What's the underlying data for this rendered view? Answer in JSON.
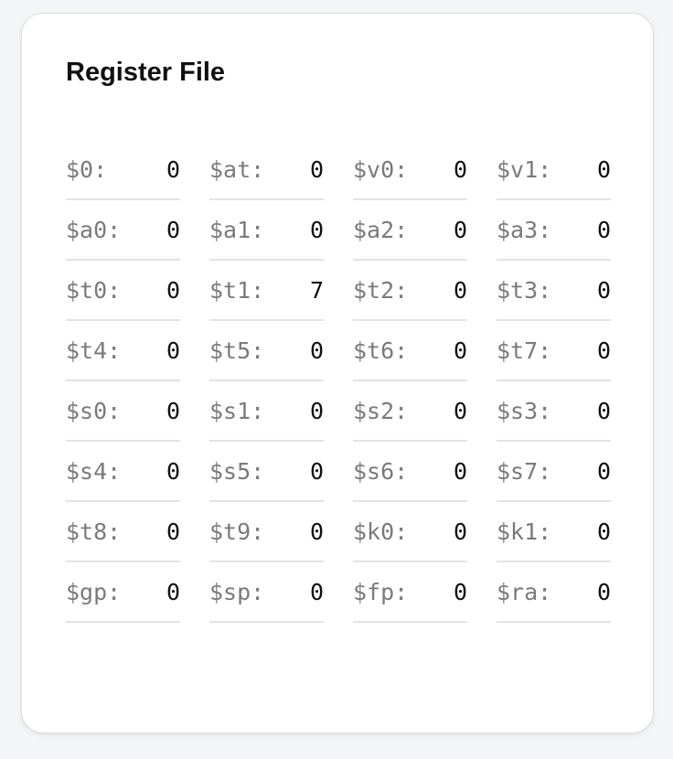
{
  "panel": {
    "title": "Register File"
  },
  "registers": [
    {
      "name": "$0:",
      "value": "0"
    },
    {
      "name": "$at:",
      "value": "0"
    },
    {
      "name": "$v0:",
      "value": "0"
    },
    {
      "name": "$v1:",
      "value": "0"
    },
    {
      "name": "$a0:",
      "value": "0"
    },
    {
      "name": "$a1:",
      "value": "0"
    },
    {
      "name": "$a2:",
      "value": "0"
    },
    {
      "name": "$a3:",
      "value": "0"
    },
    {
      "name": "$t0:",
      "value": "0"
    },
    {
      "name": "$t1:",
      "value": "7"
    },
    {
      "name": "$t2:",
      "value": "0"
    },
    {
      "name": "$t3:",
      "value": "0"
    },
    {
      "name": "$t4:",
      "value": "0"
    },
    {
      "name": "$t5:",
      "value": "0"
    },
    {
      "name": "$t6:",
      "value": "0"
    },
    {
      "name": "$t7:",
      "value": "0"
    },
    {
      "name": "$s0:",
      "value": "0"
    },
    {
      "name": "$s1:",
      "value": "0"
    },
    {
      "name": "$s2:",
      "value": "0"
    },
    {
      "name": "$s3:",
      "value": "0"
    },
    {
      "name": "$s4:",
      "value": "0"
    },
    {
      "name": "$s5:",
      "value": "0"
    },
    {
      "name": "$s6:",
      "value": "0"
    },
    {
      "name": "$s7:",
      "value": "0"
    },
    {
      "name": "$t8:",
      "value": "0"
    },
    {
      "name": "$t9:",
      "value": "0"
    },
    {
      "name": "$k0:",
      "value": "0"
    },
    {
      "name": "$k1:",
      "value": "0"
    },
    {
      "name": "$gp:",
      "value": "0"
    },
    {
      "name": "$sp:",
      "value": "0"
    },
    {
      "name": "$fp:",
      "value": "0"
    },
    {
      "name": "$ra:",
      "value": "0"
    }
  ]
}
